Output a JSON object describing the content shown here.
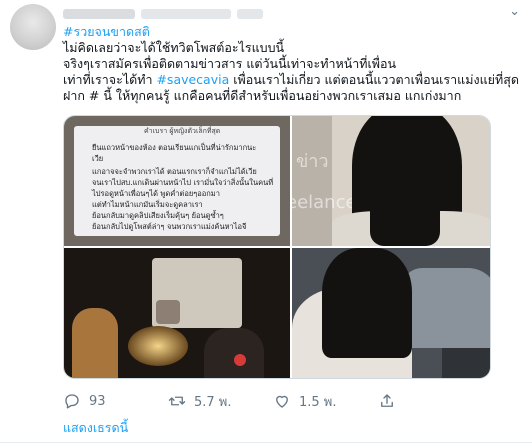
{
  "tweet": {
    "hashtag_title": "#รวยจนขาดสติ",
    "line2": "ไม่คิดเลยว่าจะได้ใช้ทวิตโพสต์อะไรแบบนี้",
    "line3": "จริงๆเราสมัครเพื่อติดตามข่าวสาร แต่วันนี้เท่าจะทำหน้าที่เพื่อน",
    "line4_pre": "เท่าที่เราจะได้ทำ ",
    "line4_tag": "#savecavia",
    "line4_post": " เพื่อนเราไม่เกี่ยว แต่ตอนนี้แววตาเพื่อนเราแม่งแย่ที่สุด",
    "line5": "ฝาก # นี้ ให้ทุกคนรู้ แกคือคนที่ดีสำหรับเพื่อนอย่างพวกเราเสมอ แกเก่งมาก"
  },
  "media": {
    "doc_title": "คำเบรา   ผู้หญิงตัวเล็กที่สุด",
    "doc_lines": [
      "ยืนแถวหน้าของห้อง ตอนเรียนแกเป็นที่น่ารักมากนะ",
      "เวีย",
      "แกอาจจะจำพวกเราได้ ตอนแรกเราก็จำแกไม่ได้เวีย",
      "จนเราไปสบ.แกเดินผ่านหน้าไป เรามั่นใจว่าสิ่งนั้นในคนที่",
      "ไปรอดูหน้าเพื่อนๆได้ พูดค่ำต่อยๆออกมา",
      "แต่ทำไมหน้าแกมันเริ่มจะดูคลาเรา",
      "ย้อนกลับมาดูคลิปเสียงเร็มคุ้นๆ ย้อนดูซ้ำๆ",
      "ย้อนกลับไปดูโพสต์ล่าๆ จนพวกเราแม่งค้นหาไอจี"
    ],
    "watermark_top": "ข่าว",
    "watermark_bottom": "eelance"
  },
  "actions": {
    "reply_count": "93",
    "retweet_count": "5.7 พ.",
    "like_count": "1.5 พ."
  },
  "show_thread": "แสดงเธรดนี้",
  "colors": {
    "accent": "#1da1f2",
    "muted": "#657786"
  },
  "icons": [
    "chevron-down-icon",
    "reply-icon",
    "retweet-icon",
    "like-icon",
    "share-icon"
  ]
}
